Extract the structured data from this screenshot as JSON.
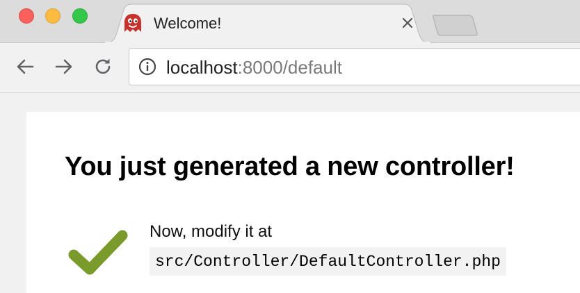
{
  "tab": {
    "title": "Welcome!",
    "favicon": "ghost-icon",
    "close_icon": "close-icon"
  },
  "toolbar": {
    "back_icon": "back-arrow-icon",
    "forward_icon": "forward-arrow-icon",
    "reload_icon": "reload-icon",
    "info_icon": "info-icon",
    "url_host": "localhost",
    "url_rest": ":8000/default"
  },
  "page": {
    "heading": "You just generated a new controller!",
    "instruction": "Now, modify it at",
    "file_path": "src/Controller/DefaultController.php",
    "check_icon": "checkmark-icon"
  },
  "colors": {
    "check_green": "#7a9a2b",
    "favicon_red": "#c8322c",
    "traffic_close": "#fc605c",
    "traffic_minimize": "#fdbc40",
    "traffic_zoom": "#34c84a"
  }
}
